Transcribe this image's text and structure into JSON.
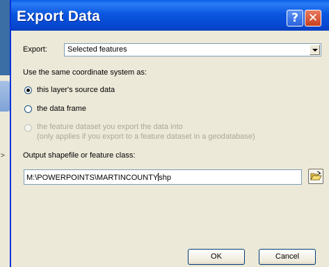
{
  "dialog": {
    "title": "Export Data",
    "help_label": "?",
    "close_label": "✕"
  },
  "export": {
    "label": "Export:",
    "selected": "Selected features"
  },
  "coordinate": {
    "label": "Use the same coordinate system as:",
    "options": [
      {
        "label": "this layer's source data",
        "checked": true,
        "enabled": true
      },
      {
        "label": "the data frame",
        "checked": false,
        "enabled": true
      },
      {
        "label": "the feature dataset you export the data into",
        "sublabel": "(only applies if you export to a feature dataset in a geodatabase)",
        "checked": false,
        "enabled": false
      }
    ]
  },
  "output": {
    "label": "Output shapefile or feature class:",
    "value_before_caret": "M:\\POWERPOINTS\\MARTINCOUNTY",
    "value_after_caret": "shp",
    "browse_icon": "open-folder-icon"
  },
  "buttons": {
    "ok": "OK",
    "cancel": "Cancel"
  },
  "colors": {
    "titlebar": "#0b57e0",
    "dialog_bg": "#ece9d8",
    "desktop": "#3a6ea5"
  }
}
